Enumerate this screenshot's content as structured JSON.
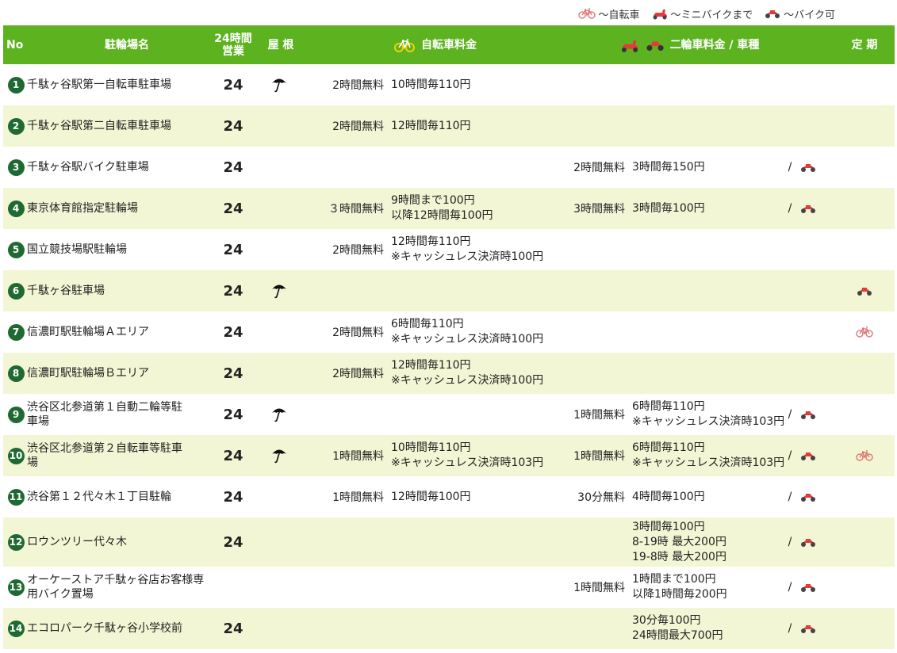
{
  "legend": [
    {
      "icon": "bicycle-icon",
      "label": "～自転車"
    },
    {
      "icon": "minibike-icon",
      "label": "～ミニバイクまで"
    },
    {
      "icon": "motorbike-icon",
      "label": "～バイク可"
    }
  ],
  "header": {
    "no": "No",
    "name": "駐輪場名",
    "hours24_line1": "24時間",
    "hours24_line2": "営業",
    "roof": "屋 根",
    "bicycle_fee": "自転車料金",
    "motorbike_fee": "二輪車料金 / 車種",
    "teiki": "定 期"
  },
  "colors": {
    "header_bg": "#5cb21f",
    "alt_row": "#f2f6d4",
    "number_badge": "#1f6a32",
    "bike_icon": "#e23b3b"
  },
  "rows": [
    {
      "no": "1",
      "name": [
        "千駄ヶ谷駅第一自転車駐車場"
      ],
      "h24": "24",
      "roof": true,
      "bike_free": "2時間無料",
      "bike_rate": [
        "10時間毎110円"
      ],
      "moto_free": "",
      "moto_rate": [],
      "moto_type": "",
      "teiki": ""
    },
    {
      "no": "2",
      "name": [
        "千駄ヶ谷駅第二自転車駐車場"
      ],
      "h24": "24",
      "roof": false,
      "bike_free": "2時間無料",
      "bike_rate": [
        "12時間毎110円"
      ],
      "moto_free": "",
      "moto_rate": [],
      "moto_type": "",
      "teiki": ""
    },
    {
      "no": "3",
      "name": [
        "千駄ヶ谷駅バイク駐車場"
      ],
      "h24": "24",
      "roof": false,
      "bike_free": "",
      "bike_rate": [],
      "moto_free": "2時間無料",
      "moto_rate": [
        "3時間毎150円"
      ],
      "moto_type": "motorbike-icon",
      "teiki": ""
    },
    {
      "no": "4",
      "name": [
        "東京体育館指定駐輪場"
      ],
      "h24": "24",
      "roof": false,
      "bike_free": "３時間無料",
      "bike_rate": [
        "9時間まで100円",
        "以降12時間毎100円"
      ],
      "moto_free": "3時間無料",
      "moto_rate": [
        "3時間毎100円"
      ],
      "moto_type": "motorbike-icon",
      "teiki": ""
    },
    {
      "no": "5",
      "name": [
        "国立競技場駅駐輪場"
      ],
      "h24": "24",
      "roof": false,
      "bike_free": "2時間無料",
      "bike_rate": [
        "12時間毎110円",
        "※キャッシュレス決済時100円"
      ],
      "moto_free": "",
      "moto_rate": [],
      "moto_type": "",
      "teiki": ""
    },
    {
      "no": "6",
      "name": [
        "千駄ヶ谷駐車場"
      ],
      "h24": "24",
      "roof": true,
      "bike_free": "",
      "bike_rate": [],
      "moto_free": "",
      "moto_rate": [],
      "moto_type": "",
      "teiki": "motorbike-icon"
    },
    {
      "no": "7",
      "name": [
        "信濃町駅駐輪場Ａエリア"
      ],
      "h24": "24",
      "roof": false,
      "bike_free": "2時間無料",
      "bike_rate": [
        "6時間毎110円",
        "※キャッシュレス決済時100円"
      ],
      "moto_free": "",
      "moto_rate": [],
      "moto_type": "",
      "teiki": "bicycle-icon"
    },
    {
      "no": "8",
      "name": [
        "信濃町駅駐輪場Ｂエリア"
      ],
      "h24": "24",
      "roof": false,
      "bike_free": "2時間無料",
      "bike_rate": [
        "12時間毎110円",
        "※キャッシュレス決済時100円"
      ],
      "moto_free": "",
      "moto_rate": [],
      "moto_type": "",
      "teiki": ""
    },
    {
      "no": "9",
      "name": [
        "渋谷区北参道第１自動二輪等駐",
        "車場"
      ],
      "h24": "24",
      "roof": true,
      "bike_free": "",
      "bike_rate": [],
      "moto_free": "1時間無料",
      "moto_rate": [
        "6時間毎110円",
        "※キャッシュレス決済時103円"
      ],
      "moto_type": "motorbike-icon",
      "teiki": ""
    },
    {
      "no": "10",
      "name": [
        "渋谷区北参道第２自転車等駐車",
        "場"
      ],
      "h24": "24",
      "roof": true,
      "bike_free": "1時間無料",
      "bike_rate": [
        "10時間毎110円",
        "※キャッシュレス決済時103円"
      ],
      "moto_free": "1時間無料",
      "moto_rate": [
        "6時間毎110円",
        "※キャッシュレス決済時103円"
      ],
      "moto_type": "motorbike-icon",
      "teiki": "bicycle-icon"
    },
    {
      "no": "11",
      "name": [
        "渋谷第１２代々木１丁目駐輪"
      ],
      "h24": "24",
      "roof": false,
      "bike_free": "1時間無料",
      "bike_rate": [
        "12時間毎100円"
      ],
      "moto_free": "30分無料",
      "moto_rate": [
        "4時間毎100円"
      ],
      "moto_type": "motorbike-icon",
      "teiki": ""
    },
    {
      "no": "12",
      "name": [
        "ロウンツリー代々木"
      ],
      "h24": "24",
      "roof": false,
      "bike_free": "",
      "bike_rate": [],
      "moto_free": "",
      "moto_rate": [
        "3時間毎100円",
        "8-19時 最大200円",
        "19-8時 最大200円"
      ],
      "moto_type": "motorbike-icon",
      "teiki": ""
    },
    {
      "no": "13",
      "name": [
        "オーケーストア千駄ヶ谷店お客様専",
        "用バイク置場"
      ],
      "h24": "",
      "roof": false,
      "bike_free": "",
      "bike_rate": [],
      "moto_free": "1時間無料",
      "moto_rate": [
        "1時間まで100円",
        "以降1時間毎200円"
      ],
      "moto_type": "motorbike-icon",
      "teiki": ""
    },
    {
      "no": "14",
      "name": [
        "エコロパーク千駄ヶ谷小学校前"
      ],
      "h24": "24",
      "roof": false,
      "bike_free": "",
      "bike_rate": [],
      "moto_free": "",
      "moto_rate": [
        "30分毎100円",
        "24時間最大700円"
      ],
      "moto_type": "motorbike-icon",
      "teiki": ""
    }
  ]
}
